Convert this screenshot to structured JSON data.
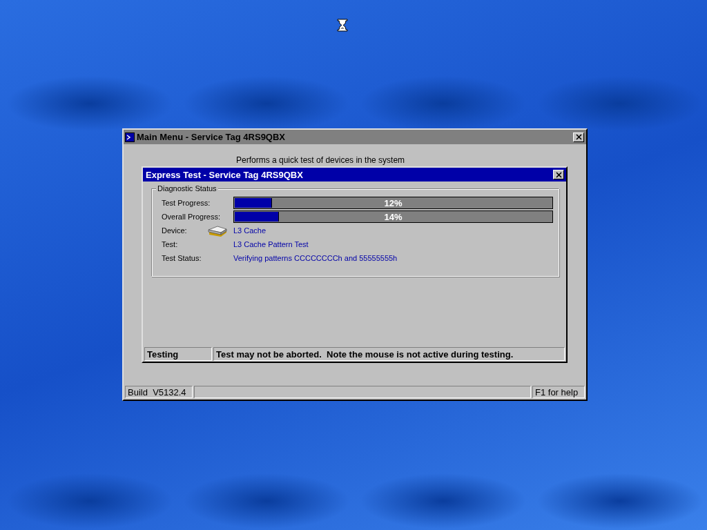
{
  "main_window": {
    "title": "Main Menu - Service Tag 4RS9QBX",
    "active": false,
    "description": "Performs a quick test of devices in the system",
    "status_bar": {
      "build": "Build  V5132.4",
      "help": "F1 for help"
    }
  },
  "dialog": {
    "title": "Express Test - Service Tag 4RS9QBX",
    "active": true,
    "group_title": "Diagnostic Status",
    "progress": [
      {
        "label": "Test Progress:",
        "level": 0.12,
        "reading": "12%"
      },
      {
        "label": "Overall Progress:",
        "level": 0.14,
        "reading": "14%"
      }
    ],
    "fields": [
      {
        "kind": "device",
        "label": "Device:",
        "value": "L3 Cache"
      },
      {
        "kind": "text",
        "label": "Test:",
        "value": "L3 Cache Pattern Test"
      },
      {
        "kind": "text",
        "label": "Test Status:",
        "value": "Verifying patterns CCCCCCCCh and 55555555h"
      }
    ],
    "status_bar": {
      "state": "Testing",
      "message": "Test may not be aborted.  Note the mouse is not active during testing."
    }
  }
}
